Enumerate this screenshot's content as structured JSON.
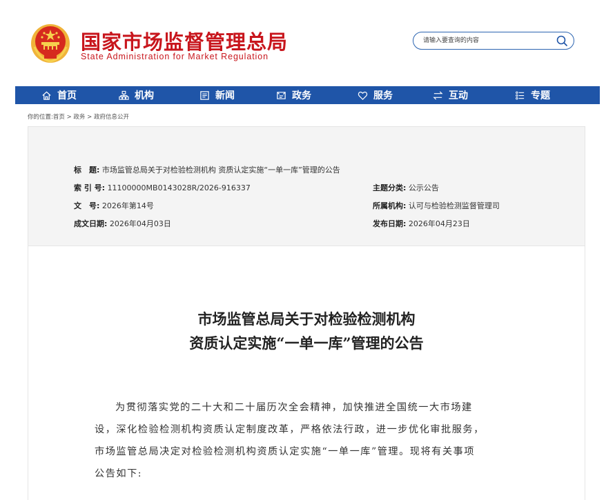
{
  "header": {
    "site_title_cn": "国家市场监督管理总局",
    "site_title_en": "State Administration for Market Regulation",
    "search_placeholder": "请输入要查询的内容",
    "brand_color": "#c8161d",
    "nav_color": "#1f55a8"
  },
  "nav": {
    "items": [
      {
        "label": "首页",
        "icon": "home-icon"
      },
      {
        "label": "机构",
        "icon": "org-chart-icon"
      },
      {
        "label": "新闻",
        "icon": "newspaper-icon"
      },
      {
        "label": "政务",
        "icon": "document-icon"
      },
      {
        "label": "服务",
        "icon": "heart-icon"
      },
      {
        "label": "互动",
        "icon": "exchange-icon"
      },
      {
        "label": "专题",
        "icon": "list-icon"
      }
    ]
  },
  "breadcrumb": {
    "prefix": "你的位置:",
    "items": [
      "首页",
      "政务",
      "政府信息公开"
    ],
    "separator": " > "
  },
  "meta": {
    "title_label": "标　题:",
    "title_value": "市场监管总局关于对检验检测机构 资质认定实施“一单一库”管理的公告",
    "index_label": "索 引 号:",
    "index_value": "11100000MB0143028R/2026-916337",
    "topic_label": "主题分类:",
    "topic_value": "公示公告",
    "doc_no_label": "文　号:",
    "doc_no_value": "2026年第14号",
    "org_label": "所属机构:",
    "org_value": "认可与检验检测监督管理司",
    "written_label": "成文日期:",
    "written_value": "2026年04月03日",
    "publish_label": "发布日期:",
    "publish_value": "2026年04月23日"
  },
  "document": {
    "title_line1": "市场监管总局关于对检验检测机构",
    "title_line2": "资质认定实施“一单一库”管理的公告",
    "para_lines": [
      "为贯彻落实党的二十大和二十届历次全会精神，加快推进全国统一大市场建",
      "设，深化检验检测机构资质认定制度改革，严格依法行政，进一步优化审批服务，",
      "市场监管总局决定对检验检测机构资质认定实施“一单一库”管理。现将有关事项",
      "公告如下:"
    ]
  }
}
